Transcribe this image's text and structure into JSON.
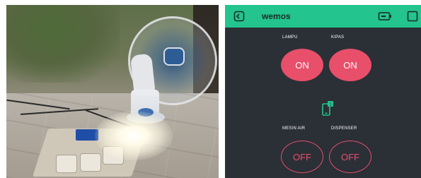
{
  "app": {
    "title": "wemos",
    "accent_color": "#23c48e",
    "button_color": "#e84f6a",
    "background_color": "#2b2f36",
    "header_icons": [
      "device-back-icon",
      "battery-icon",
      "square-icon"
    ]
  },
  "widgets": {
    "lampu": {
      "label": "LAMPU",
      "state": "ON"
    },
    "kipas": {
      "label": "KIPAS",
      "state": "ON"
    },
    "mesin_air": {
      "label": "MESIN AIR",
      "state": "OFF"
    },
    "dispenser": {
      "label": "DISPENSER",
      "state": "OFF"
    },
    "device_icon": {
      "icon": "phone-icon",
      "badge": "1"
    }
  },
  "photo": {
    "subject": [
      "fan-icon",
      "lamp-icon",
      "power-board-icon"
    ]
  }
}
